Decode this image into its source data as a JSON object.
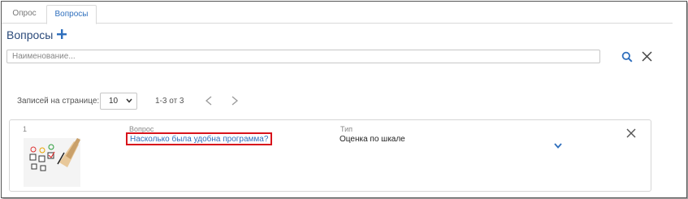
{
  "tabs": [
    {
      "label": "Опрос",
      "active": false
    },
    {
      "label": "Вопросы",
      "active": true
    }
  ],
  "section": {
    "title": "Вопросы",
    "add_icon": "plus-icon"
  },
  "search": {
    "placeholder": "Наименование...",
    "search_icon": "search-icon",
    "clear_icon": "close-icon"
  },
  "pager": {
    "label": "Записей на странице:",
    "page_size": "10",
    "range": "1-3 от 3",
    "prev_icon": "chevron-left-icon",
    "next_icon": "chevron-right-icon"
  },
  "rows": [
    {
      "index": "1",
      "question_label": "Вопрос",
      "question": "Насколько была удобна программа?",
      "type_label": "Тип",
      "type": "Оценка по шкале",
      "image": "survey-checklist-image",
      "expand_icon": "chevron-down-icon",
      "remove_icon": "close-icon"
    }
  ],
  "colors": {
    "accent": "#2f6fbd",
    "highlight": "#d8141c",
    "title": "#2b4a7a"
  }
}
